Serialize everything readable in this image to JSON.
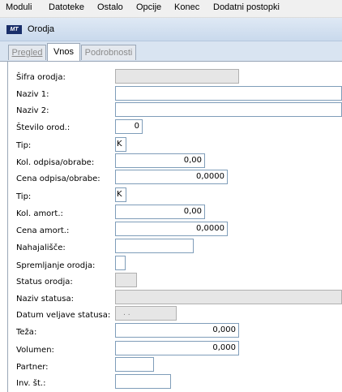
{
  "menu": [
    "Moduli",
    "Datoteke",
    "Ostalo",
    "Opcije",
    "Konec",
    "Dodatni postopki"
  ],
  "window": {
    "logo_text": "MT",
    "title": "Orodja"
  },
  "tabs": [
    {
      "label": "Pregled",
      "state": "disabled"
    },
    {
      "label": "Vnos",
      "state": "active"
    },
    {
      "label": "Podrobnosti",
      "state": "disabled"
    }
  ],
  "form": {
    "sifra": {
      "label": "Šifra orodja:",
      "value": ""
    },
    "naziv1": {
      "label": "Naziv 1:",
      "value": ""
    },
    "naziv2": {
      "label": "Naziv 2:",
      "value": ""
    },
    "stevilo": {
      "label": "Število orod.:",
      "value": "0"
    },
    "tip1": {
      "label": "Tip:",
      "value": "K"
    },
    "kol_odpisa": {
      "label": "Kol. odpisa/obrabe:",
      "value": "0,00"
    },
    "cena_odpisa": {
      "label": "Cena odpisa/obrabe:",
      "value": "0,0000"
    },
    "tip2": {
      "label": "Tip:",
      "value": "K"
    },
    "kol_amort": {
      "label": "Kol. amort.:",
      "value": "0,00"
    },
    "cena_amort": {
      "label": "Cena amort.:",
      "value": "0,0000"
    },
    "nahajalisce": {
      "label": "Nahajališče:",
      "value": ""
    },
    "spremljanje": {
      "label": "Spremljanje orodja:",
      "value": ""
    },
    "status": {
      "label": "Status orodja:",
      "value": ""
    },
    "naziv_statusa": {
      "label": "Naziv statusa:",
      "value": ""
    },
    "datum_veljave": {
      "label": "Datum veljave statusa:",
      "value": ". ."
    },
    "teza": {
      "label": "Teža:",
      "value": "0,000"
    },
    "volumen": {
      "label": "Volumen:",
      "value": "0,000"
    },
    "partner": {
      "label": "Partner:",
      "value": ""
    },
    "inv_st": {
      "label": "Inv. št.:",
      "value": ""
    }
  }
}
